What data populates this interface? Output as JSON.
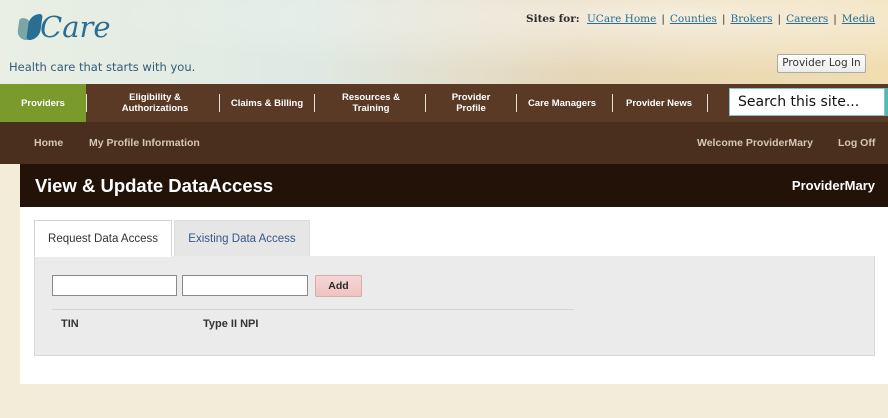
{
  "brand": {
    "logo_text": "Care",
    "tagline": "Health care that starts with you."
  },
  "sites_bar": {
    "label": "Sites for:",
    "links": [
      "UCare Home",
      "Counties",
      "Brokers",
      "Careers",
      "Media"
    ]
  },
  "login_button": "Provider Log In",
  "nav": {
    "items": [
      {
        "label": "Providers",
        "active": true
      },
      {
        "label": "Eligibility & Authorizations"
      },
      {
        "label": "Claims & Billing"
      },
      {
        "label": "Resources & Training"
      },
      {
        "label": "Provider Profile"
      },
      {
        "label": "Care Managers"
      },
      {
        "label": "Provider News"
      }
    ],
    "search_placeholder": "Search this site..."
  },
  "subnav": {
    "home": "Home",
    "profile": "My Profile Information",
    "welcome": "Welcome ProviderMary",
    "logoff": "Log Off"
  },
  "page": {
    "title": "View & Update DataAccess",
    "user": "ProviderMary"
  },
  "tabs": [
    {
      "label": "Request Data Access",
      "active": true
    },
    {
      "label": "Existing Data Access",
      "active": false
    }
  ],
  "form": {
    "tin_value": "",
    "npi_value": "",
    "add_label": "Add",
    "columns": [
      "TIN",
      "Type II NPI"
    ]
  },
  "colors": {
    "nav_bg": "#5a3a25",
    "active_nav": "#7a9a2c",
    "title_bar": "#221208",
    "brand_blue": "#2a6e92"
  }
}
